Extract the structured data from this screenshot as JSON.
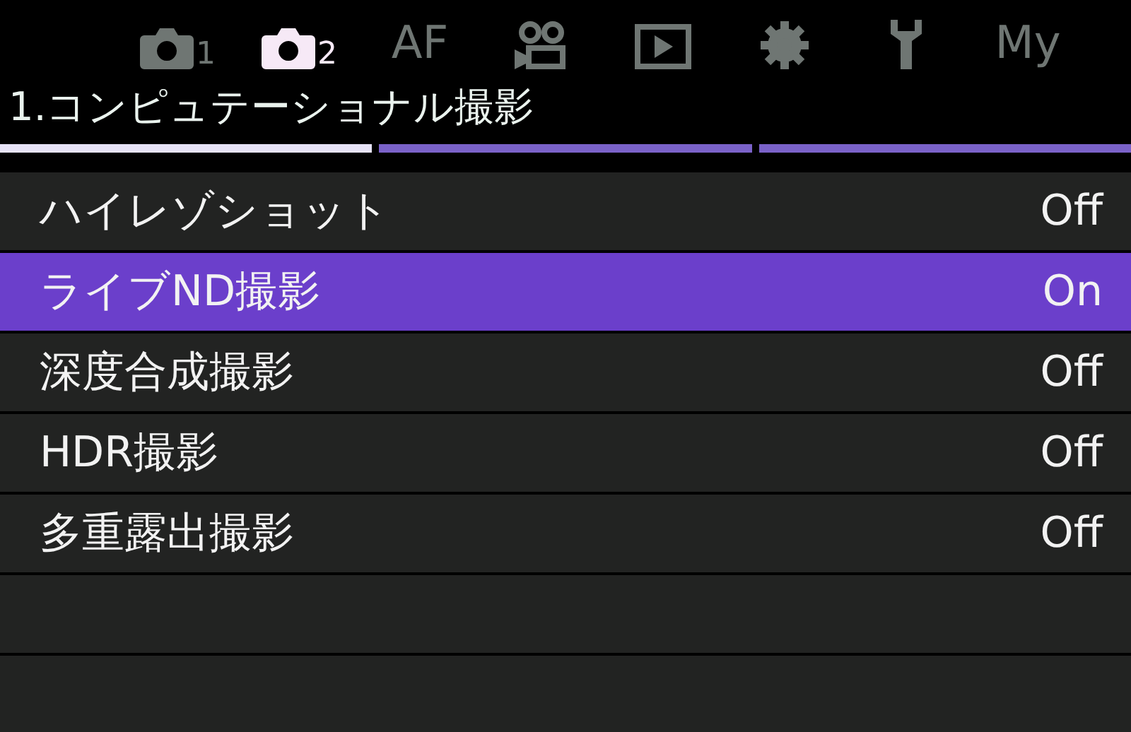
{
  "tabs": [
    {
      "kind": "camera",
      "label": "1",
      "selected": false
    },
    {
      "kind": "camera",
      "label": "2",
      "selected": true
    },
    {
      "kind": "text",
      "label": "AF",
      "selected": false
    },
    {
      "kind": "video",
      "selected": false
    },
    {
      "kind": "play",
      "selected": false
    },
    {
      "kind": "gear",
      "selected": false
    },
    {
      "kind": "wrench",
      "selected": false
    },
    {
      "kind": "text",
      "label": "My",
      "selected": false
    }
  ],
  "page_title": "1.コンピュテーショナル撮影",
  "pages": [
    {
      "selected": true
    },
    {
      "selected": false
    },
    {
      "selected": false
    }
  ],
  "rows": [
    {
      "label": "ハイレゾショット",
      "value": "Off",
      "selected": false
    },
    {
      "label": "ライブND撮影",
      "value": "On",
      "selected": true
    },
    {
      "label": "深度合成撮影",
      "value": "Off",
      "selected": false
    },
    {
      "label": "HDR撮影",
      "value": "Off",
      "selected": false
    },
    {
      "label": "多重露出撮影",
      "value": "Off",
      "selected": false
    }
  ]
}
